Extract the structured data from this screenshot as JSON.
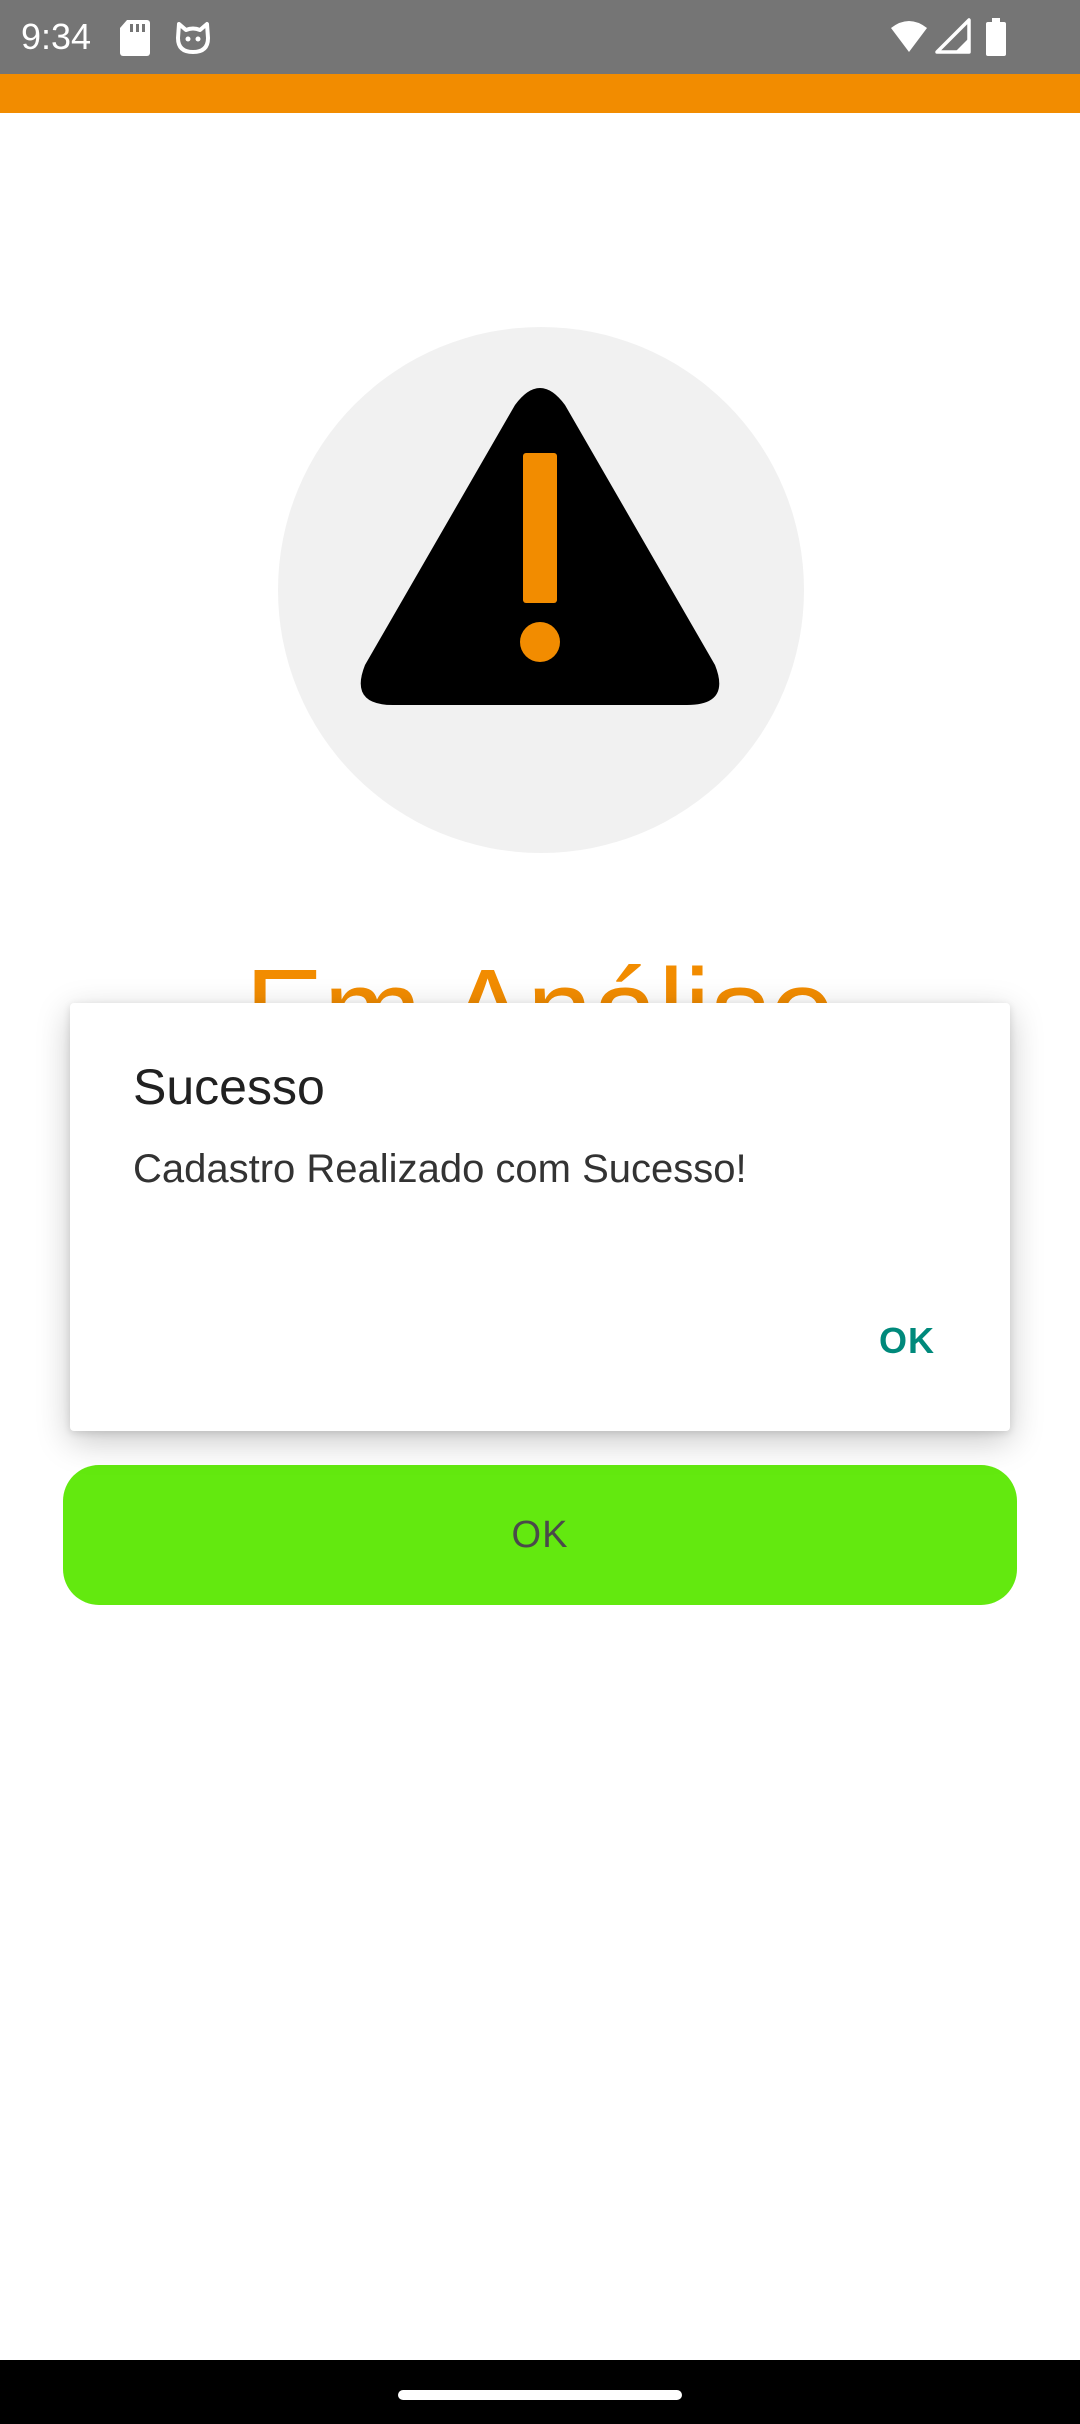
{
  "status_bar": {
    "time": "9:34",
    "icons": [
      "sd-card-icon",
      "cat-icon",
      "wifi-icon",
      "signal-icon",
      "battery-icon"
    ]
  },
  "colors": {
    "accent": "#f28c00",
    "status_bar": "#757575",
    "button_green": "#63e90f",
    "dialog_action": "#00897b"
  },
  "main": {
    "icon": "warning-icon",
    "status_title": "Em Análise",
    "ok_button_label": "OK"
  },
  "dialog": {
    "title": "Sucesso",
    "message": "Cadastro Realizado com Sucesso!",
    "ok_label": "OK"
  }
}
